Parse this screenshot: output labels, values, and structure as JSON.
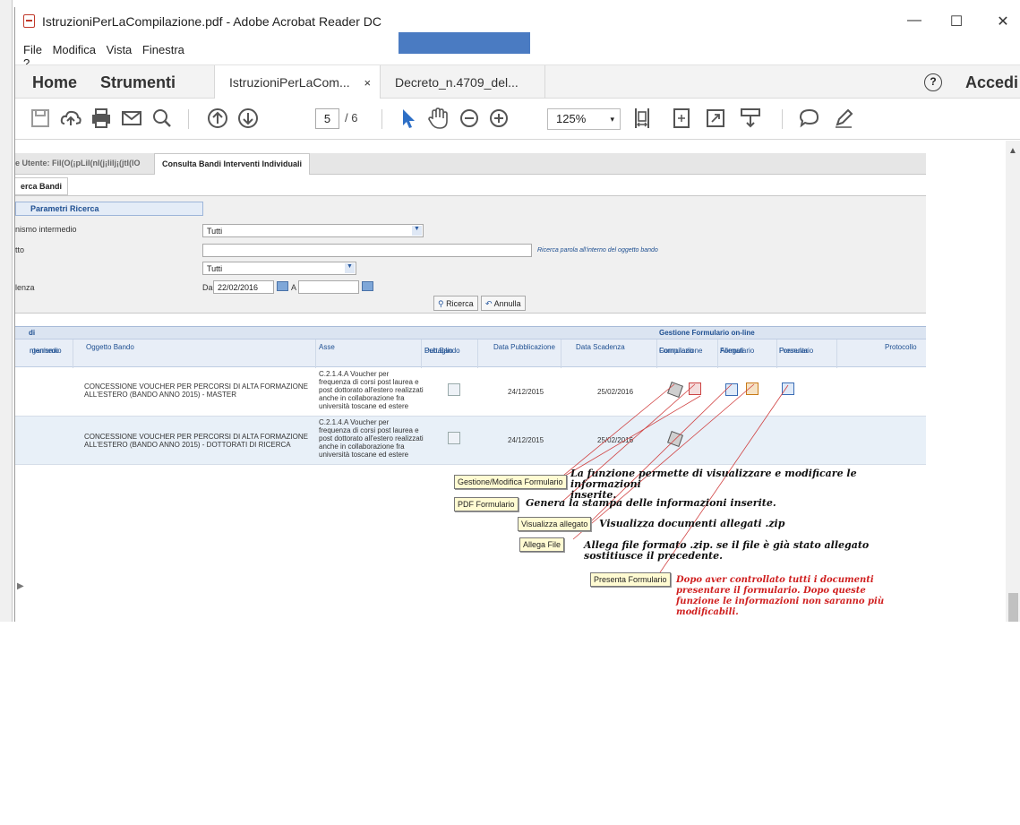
{
  "window": {
    "title": "IstruzioniPerLaCompilazione.pdf - Adobe Acrobat Reader DC",
    "controls": [
      "—",
      "☐",
      "✕"
    ]
  },
  "menu": [
    "File",
    "Modifica",
    "Vista",
    "Finestra",
    "?"
  ],
  "tabs": {
    "home": "Home",
    "tools": "Strumenti",
    "documents": [
      {
        "label": "IstruzioniPerLaCom...",
        "close": "×",
        "active": true
      },
      {
        "label": "Decreto_n.4709_del...",
        "close": "",
        "active": false
      }
    ],
    "help": "?",
    "signin": "Accedi"
  },
  "toolbar": {
    "page_current": "5",
    "page_total": "/ 6",
    "zoom": "125%",
    "zoom_caret": "▾",
    "icons": [
      "save-icon",
      "upload-icon",
      "print-icon",
      "email-icon",
      "search-icon",
      "page-up-icon",
      "page-down-icon",
      "select-cursor-icon",
      "hand-tool-icon",
      "zoom-out-icon",
      "zoom-in-icon",
      "fit-width-icon",
      "fit-page-icon",
      "fullscreen-icon",
      "scroll-mode-icon",
      "comment-icon",
      "sign-pen-icon"
    ]
  },
  "webpage": {
    "tab_user": "e Utente: FiI(O(¡pLiI(nI(j¡IiIj¡(jtI(IO",
    "tab_consulta": "Consulta Bandi Interventi Individuali",
    "subtab": "erca Bandi",
    "params_header": "Parametri Ricerca",
    "fields": [
      {
        "label": "nismo intermedio",
        "value": "Tutti"
      },
      {
        "label": "tto",
        "value": ""
      },
      {
        "label": "",
        "value": "Tutti"
      },
      {
        "label": "lenza",
        "from_label": "Da",
        "from": "22/02/2016",
        "to_label": "A",
        "to": ""
      }
    ],
    "hint": "Ricerca parola all'interno del oggetto bando",
    "btn_search": "Ricerca",
    "btn_cancel": "Annulla",
    "results_title": "di",
    "group_header": "Gestione Formulario on-line",
    "columns": {
      "organismo": [
        "rganismo",
        "ntermedio"
      ],
      "oggetto": "Oggetto Bando",
      "asse": "Asse",
      "dettaglio": [
        "Dettaglio",
        "Pub.Bando"
      ],
      "pubblicazione": "Data Pubblicazione",
      "scadenza": "Data Scadenza",
      "compilazione": [
        "Compilazione",
        "Formulario"
      ],
      "allegati": [
        "Allegati",
        "Formulario"
      ],
      "presenta": [
        "Presenta",
        "Formulario"
      ],
      "protocollo": "Protocollo"
    },
    "rows": [
      {
        "oggetto": [
          "CONCESSIONE VOUCHER PER PERCORSI DI ALTA FORMAZIONE",
          "ALL'ESTERO (BANDO ANNO 2015) - MASTER"
        ],
        "asse": [
          "C.2.1.4.A Voucher per",
          "frequenza di corsi post laurea e",
          "post dottorato all'estero realizzati",
          "anche in collaborazione fra",
          "università toscane ed estere"
        ],
        "pubblicazione": "24/12/2015",
        "scadenza": "25/02/2016"
      },
      {
        "oggetto": [
          "CONCESSIONE VOUCHER PER PERCORSI DI ALTA FORMAZIONE",
          "ALL'ESTERO (BANDO ANNO 2015) - DOTTORATI DI RICERCA"
        ],
        "asse": [
          "C.2.1.4.A Voucher per",
          "frequenza di corsi post laurea e",
          "post dottorato all'estero realizzati",
          "anche in collaborazione fra",
          "università toscane ed estere"
        ],
        "pubblicazione": "24/12/2015",
        "scadenza": "25/02/2016"
      }
    ]
  },
  "annotations": [
    {
      "label": "Gestione/Modifica Formulario",
      "text": [
        "La funzione permette di visualizzare e modificare le informazioni",
        "inserite."
      ]
    },
    {
      "label": "PDF Formulario",
      "text": [
        "Genera la stampa delle informazioni inserite."
      ]
    },
    {
      "label": "Visualizza allegato",
      "text": [
        "Visualizza documenti allegati .zip"
      ]
    },
    {
      "label": "Allega File",
      "text": [
        "Allega file formato .zip. se il file è già stato allegato",
        "sostitiusce il precedente."
      ]
    },
    {
      "label": "Presenta Formulario",
      "text": [
        "Dopo aver controllato tutti i documenti",
        "presentare il formulario. Dopo queste",
        "funzione le informazioni non saranno più",
        "modificabili."
      ]
    }
  ],
  "colors": {
    "accent_blue": "#4a7bc2",
    "callout_bg": "#fffbd2",
    "red_text": "#d02020",
    "link_line": "#d04040"
  }
}
